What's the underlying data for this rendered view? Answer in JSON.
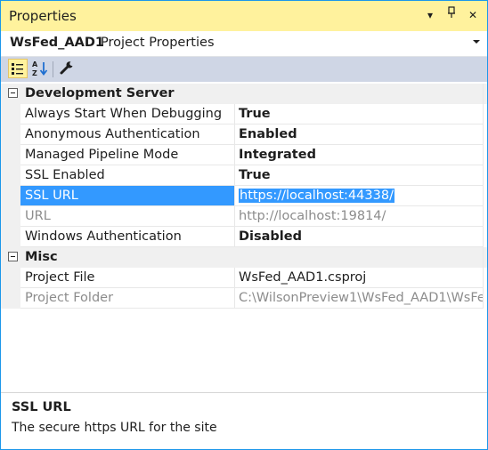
{
  "panel": {
    "title": "Properties",
    "dropdown_glyph": "▾",
    "pin_glyph": "⊥",
    "close_glyph": "✕"
  },
  "object": {
    "name": "WsFed_AAD1",
    "type": "Project Properties"
  },
  "toolbar": {
    "categorized_icon": "categorized-icon",
    "alphabetical_icon": "sort-az-icon",
    "pages_icon": "wrench-icon",
    "active_tool": "categorized"
  },
  "categories": [
    {
      "label": "Development Server",
      "rows": [
        {
          "name": "Always Start When Debugging",
          "value": "True"
        },
        {
          "name": "Anonymous Authentication",
          "value": "Enabled"
        },
        {
          "name": "Managed Pipeline Mode",
          "value": "Integrated"
        },
        {
          "name": "SSL Enabled",
          "value": "True"
        },
        {
          "name": "SSL URL",
          "value": "https://localhost:44338/"
        },
        {
          "name": "URL",
          "value": "http://localhost:19814/"
        },
        {
          "name": "Windows Authentication",
          "value": "Disabled"
        }
      ]
    },
    {
      "label": "Misc",
      "rows": [
        {
          "name": "Project File",
          "value": "WsFed_AAD1.csproj"
        },
        {
          "name": "Project Folder",
          "value": "C:\\WilsonPreview1\\WsFed_AAD1\\WsFed_"
        }
      ]
    }
  ],
  "selected_property": "SSL URL",
  "description": {
    "title": "SSL URL",
    "text": "The secure https URL for the site"
  },
  "colors": {
    "accent_border": "#1c97ea",
    "title_bar": "#fff29d",
    "toolbar": "#cfd6e5",
    "selection": "#3399ff"
  }
}
